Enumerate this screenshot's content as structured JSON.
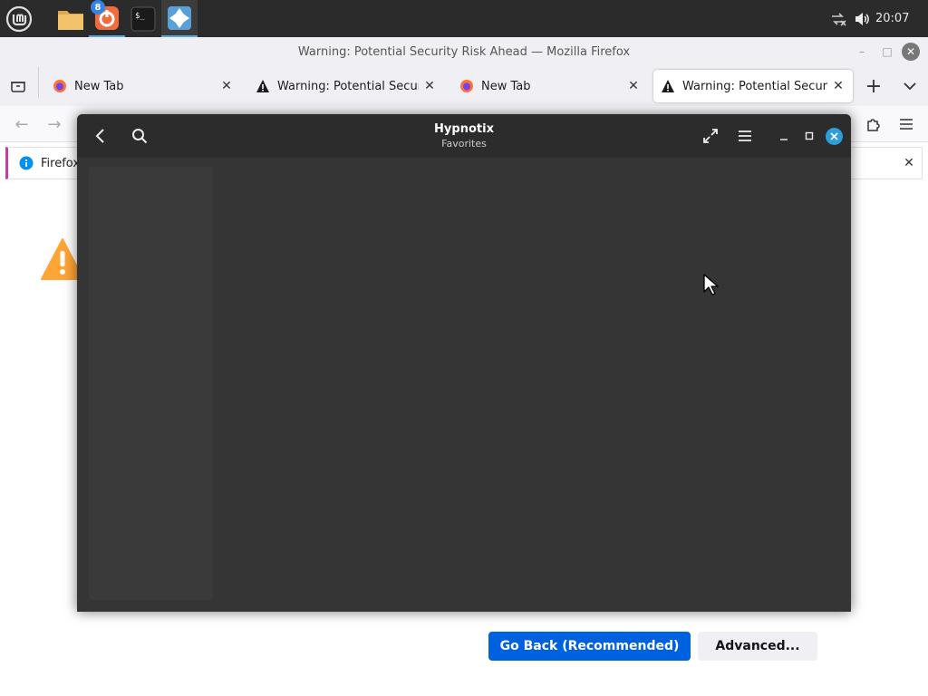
{
  "taskbar": {
    "badge_count": "8",
    "clock": "20:07",
    "icons": [
      "mint-menu-icon",
      "files-icon",
      "vpn-icon",
      "terminal-icon",
      "hypnotix-icon",
      "network-icon",
      "volume-icon"
    ]
  },
  "firefox": {
    "window_title": "Warning: Potential Security Risk Ahead — Mozilla Firefox",
    "tabs": [
      {
        "label": "New Tab",
        "icon": "firefox-icon"
      },
      {
        "label": "Warning: Potential Security Risk Ahead",
        "icon": "warning-icon"
      },
      {
        "label": "New Tab",
        "icon": "firefox-icon"
      },
      {
        "label": "Warning: Potential Security Risk Ahead",
        "icon": "warning-icon",
        "active": true
      }
    ],
    "notification_text": "Firefox",
    "go_back_label": "Go Back (Recommended)",
    "advanced_label": "Advanced...",
    "colors": {
      "primary_button": "#0061e0",
      "warning": "#ffa436"
    }
  },
  "hypnotix": {
    "title": "Hypnotix",
    "subtitle": "Favorites",
    "colors": {
      "background": "#353535",
      "header": "#2c2c2c",
      "close": "#2d9fd8"
    }
  }
}
